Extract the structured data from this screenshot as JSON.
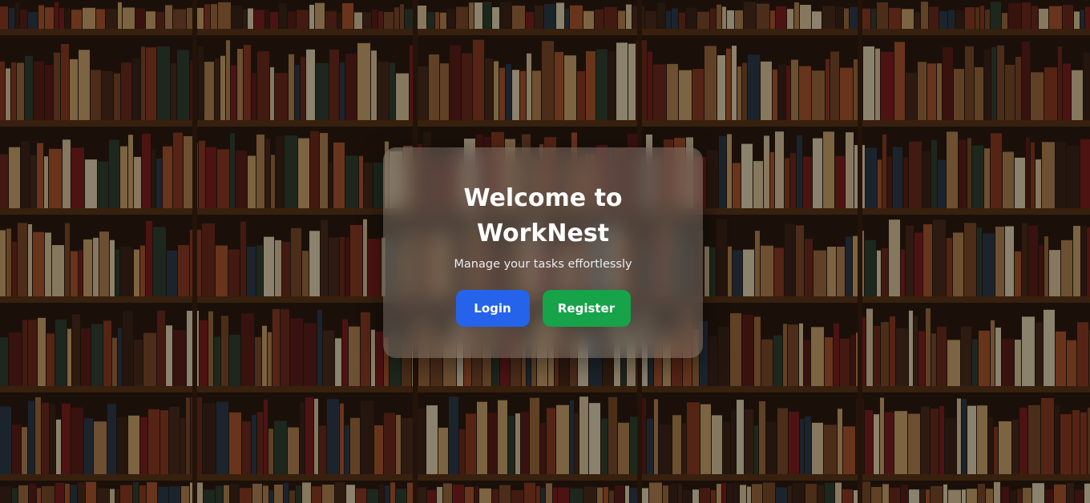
{
  "page": {
    "heading": "Welcome to WorkNest",
    "subtitle": "Manage your tasks effortlessly"
  },
  "buttons": {
    "login_label": "Login",
    "register_label": "Register"
  },
  "background": {
    "description_icon": "bookshelf-background"
  },
  "colors": {
    "login": "#2563eb",
    "register": "#16a34a",
    "card_overlay": "rgba(140,130,125,0.42)"
  }
}
